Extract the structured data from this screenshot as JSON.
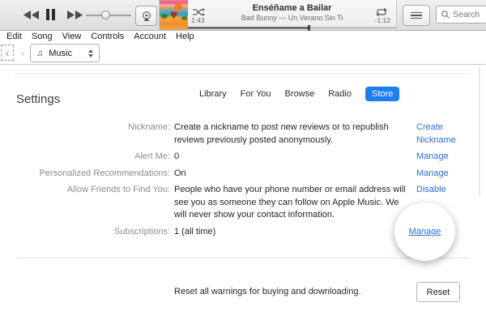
{
  "colors": {
    "accent": "#1b7ef2",
    "link": "#2d70c9"
  },
  "icons": {
    "music_note": "♫",
    "heart": "♥",
    "chevron_left": "‹",
    "chevron_right": "›"
  },
  "player": {
    "now_playing": {
      "title": "Enséñame a Bailar",
      "artist_album": "Bad Bunny — Un Verano Sin Ti",
      "elapsed": "1:43",
      "remaining": "-1:12",
      "progress_pct": 58
    },
    "volume_pct": 42,
    "search": {
      "placeholder": "Search"
    }
  },
  "menu_bar": {
    "items": [
      "Edit",
      "Song",
      "View",
      "Controls",
      "Account",
      "Help"
    ]
  },
  "nav": {
    "media_picker": "Music",
    "tabs": [
      {
        "label": "Library",
        "active": false
      },
      {
        "label": "For You",
        "active": false
      },
      {
        "label": "Browse",
        "active": false
      },
      {
        "label": "Radio",
        "active": false
      },
      {
        "label": "Store",
        "active": true
      }
    ]
  },
  "content": {
    "heading": "Settings",
    "rows": [
      {
        "label": "Nickname:",
        "value": "Create a nickname to post new reviews or to republish reviews previously posted anonymously.",
        "link": "Create Nickname",
        "highlighted": false
      },
      {
        "label": "Alert Me:",
        "value": "0",
        "link": "Manage",
        "highlighted": false
      },
      {
        "label": "Personalized Recommendations:",
        "value": "On",
        "link": "Manage",
        "highlighted": false
      },
      {
        "label": "Allow Friends to Find You:",
        "value": "People who have your phone number or email address will see you as someone they can follow on Apple Music. We will never show your contact information.",
        "link": "Disable",
        "highlighted": false
      },
      {
        "label": "Subscriptions:",
        "value": "1 (all time)",
        "link": "Manage",
        "highlighted": true
      }
    ],
    "reset": {
      "text": "Reset all warnings for buying and downloading.",
      "button": "Reset"
    }
  }
}
